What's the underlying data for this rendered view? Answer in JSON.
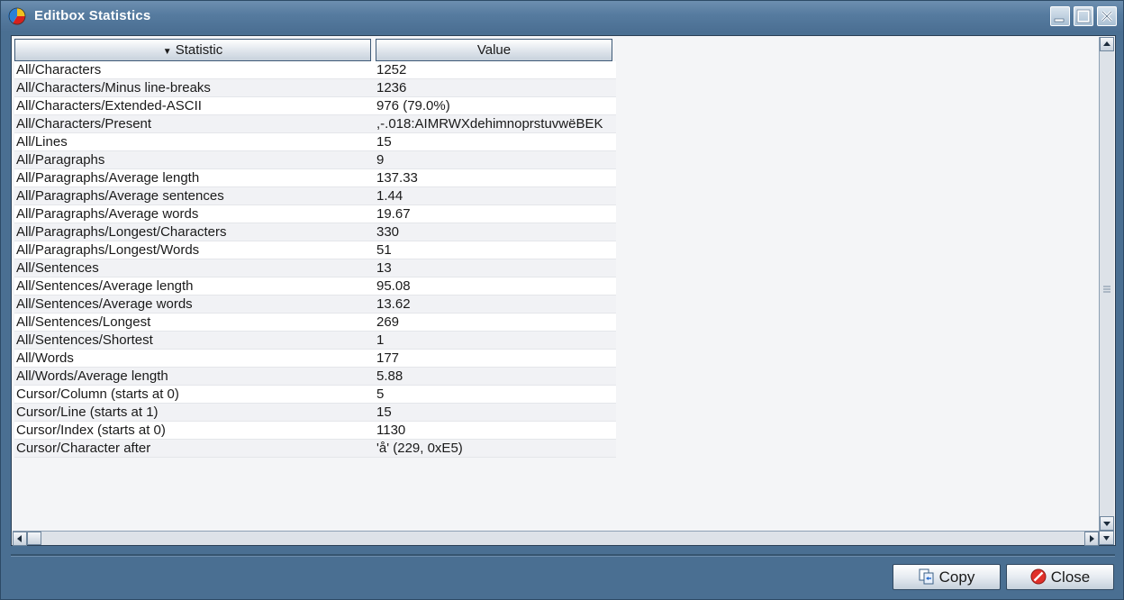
{
  "window": {
    "title": "Editbox Statistics",
    "icons": {
      "app": "pie-chart-icon",
      "minimize": "minimize-icon",
      "maximize": "maximize-icon",
      "close": "close-icon"
    }
  },
  "table": {
    "columns": [
      "Statistic",
      "Value"
    ],
    "sort_indicator": "▼",
    "rows": [
      [
        "All/Characters",
        "1252"
      ],
      [
        "All/Characters/Minus line-breaks",
        "1236"
      ],
      [
        "All/Characters/Extended-ASCII",
        "976 (79.0%)"
      ],
      [
        "All/Characters/Present",
        " ,-.018:AIMRWXdehimnoprstuvwëBEK"
      ],
      [
        "All/Lines",
        "15"
      ],
      [
        "All/Paragraphs",
        "9"
      ],
      [
        "All/Paragraphs/Average length",
        "137.33"
      ],
      [
        "All/Paragraphs/Average sentences",
        "1.44"
      ],
      [
        "All/Paragraphs/Average words",
        "19.67"
      ],
      [
        "All/Paragraphs/Longest/Characters",
        "330"
      ],
      [
        "All/Paragraphs/Longest/Words",
        "51"
      ],
      [
        "All/Sentences",
        "13"
      ],
      [
        "All/Sentences/Average length",
        "95.08"
      ],
      [
        "All/Sentences/Average words",
        "13.62"
      ],
      [
        "All/Sentences/Longest",
        "269"
      ],
      [
        "All/Sentences/Shortest",
        "1"
      ],
      [
        "All/Words",
        "177"
      ],
      [
        "All/Words/Average length",
        "5.88"
      ],
      [
        "Cursor/Column (starts at 0)",
        "5"
      ],
      [
        "Cursor/Line (starts at 1)",
        "15"
      ],
      [
        "Cursor/Index (starts at 0)",
        "1130"
      ],
      [
        "Cursor/Character after",
        "'å' (229, 0xE5)"
      ]
    ]
  },
  "buttons": {
    "copy_label": "Copy",
    "close_label": "Close",
    "copy_icon": "copy-icon",
    "close_icon": "stop-icon"
  },
  "colors": {
    "frame": "#4a6f92",
    "titlebar": "#567b9f",
    "grid_background": "#f4f5f7"
  }
}
